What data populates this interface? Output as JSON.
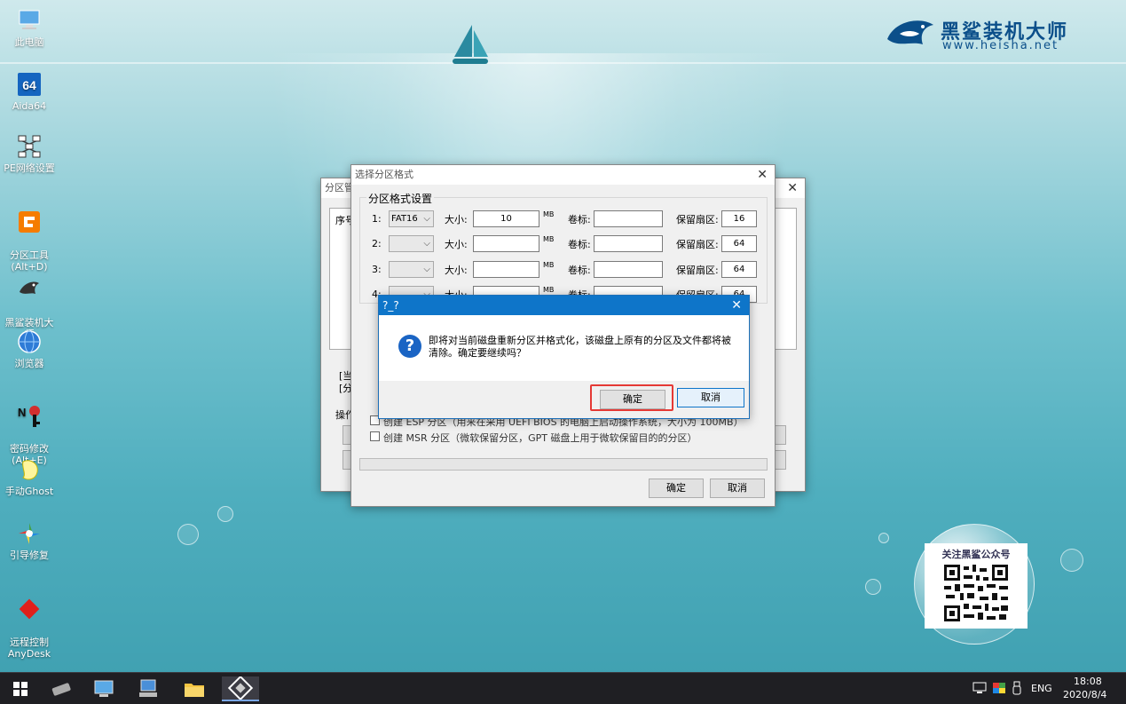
{
  "desktop": {
    "icons": [
      {
        "label": "此电脑",
        "icon": "computer-icon"
      },
      {
        "label": "Aida64",
        "icon": "aida64-icon",
        "badge": "64"
      },
      {
        "label": "PE网络设置",
        "icon": "network-settings-icon"
      },
      {
        "label": "分区工具\n(Alt+D)",
        "icon": "partition-tool-icon"
      },
      {
        "label": "黑鲨装机大\n师",
        "icon": "heisha-shark-icon"
      },
      {
        "label": "浏览器",
        "icon": "browser-globe-icon"
      },
      {
        "label": "密码修改\n(Alt+E)",
        "icon": "password-key-icon"
      },
      {
        "label": "手动Ghost",
        "icon": "ghost-icon"
      },
      {
        "label": "引导修复",
        "icon": "boot-repair-icon"
      },
      {
        "label": "远程控制\nAnyDesk",
        "icon": "anydesk-icon"
      }
    ]
  },
  "brand": {
    "name": "黑鲨装机大师",
    "url": "www.heisha.net",
    "color": "#0b4f8a"
  },
  "qr_promo": {
    "title": "关注黑鲨公众号"
  },
  "back_window": {
    "title": "分区管",
    "list_header": "序号",
    "label_fen1": "分[",
    "label_dang": "[当",
    "label_fen2": "[分",
    "label_fen3": "分[",
    "label_caozuo": "操作"
  },
  "format_window": {
    "title": "选择分区格式",
    "group_title": "分区格式设置",
    "size_label": "大小:",
    "unit": "MB",
    "volume_label": "卷标:",
    "reserved_label": "保留扇区:",
    "rows": [
      {
        "index": "1:",
        "fs": "FAT16",
        "size": "10",
        "volume": "",
        "reserved": "16"
      },
      {
        "index": "2:",
        "fs": "",
        "size": "",
        "volume": "",
        "reserved": "64"
      },
      {
        "index": "3:",
        "fs": "",
        "size": "",
        "volume": "",
        "reserved": "64"
      },
      {
        "index": "4:",
        "fs": "",
        "size": "",
        "volume": "",
        "reserved": "64"
      }
    ],
    "esp_option": "创建 ESP 分区（用来在采用 UEFI BIOS 的电脑上启动操作系统，大小为 100MB）",
    "msr_option": "创建 MSR 分区（微软保留分区，GPT 磁盘上用于微软保留目的的分区）",
    "ok_label": "确定",
    "cancel_label": "取消"
  },
  "confirm_dialog": {
    "title": "?_?",
    "message": "即将对当前磁盘重新分区并格式化，该磁盘上原有的分区及文件都将被清除。确定要继续吗？",
    "ok_label": "确定",
    "cancel_label": "取消",
    "highlight_color": "#e53935"
  },
  "taskbar": {
    "lang": "ENG",
    "time": "18:08",
    "date": "2020/8/4"
  }
}
